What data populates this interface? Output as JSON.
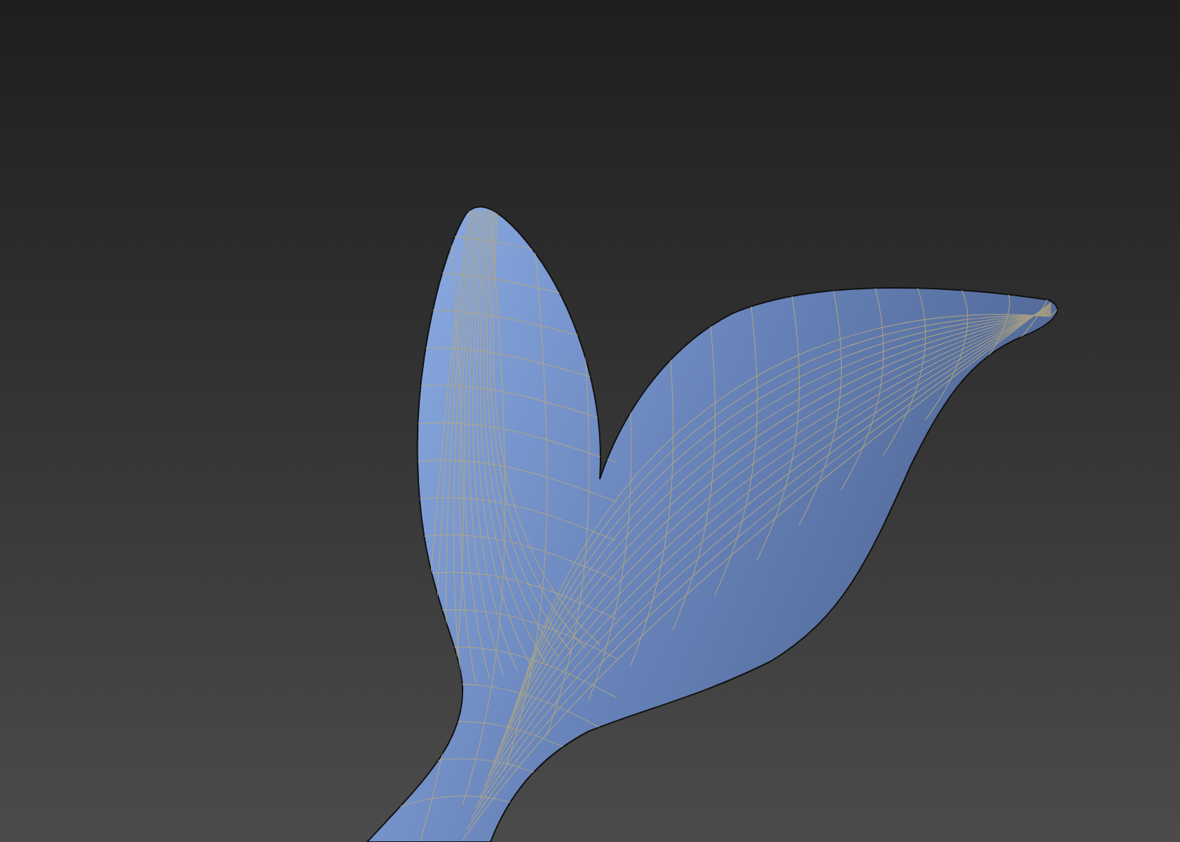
{
  "viewport": {
    "wireframe_overlay": true
  }
}
